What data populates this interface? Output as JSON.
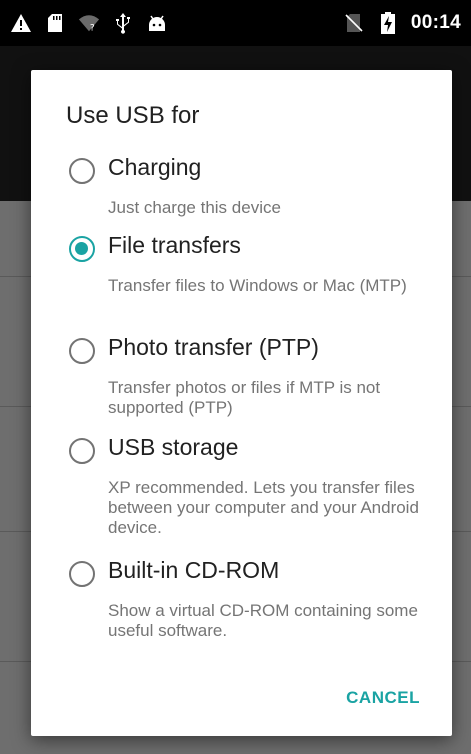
{
  "status_bar": {
    "time": "00:14",
    "icons": [
      "warning-icon",
      "sd-card-icon",
      "wifi-no-connection-icon",
      "usb-icon",
      "android-icon",
      "no-sim-icon",
      "battery-charging-icon"
    ]
  },
  "dialog": {
    "title": "Use USB for",
    "options": [
      {
        "label": "Charging",
        "description": "Just charge this device",
        "selected": false
      },
      {
        "label": "File transfers",
        "description": "Transfer files to Windows or Mac (MTP)",
        "selected": true
      },
      {
        "label": "Photo transfer (PTP)",
        "description": "Transfer photos or files if MTP is not supported (PTP)",
        "selected": false
      },
      {
        "label": "USB storage",
        "description": "XP recommended. Lets you transfer files between your computer and your Android device.",
        "selected": false
      },
      {
        "label": "Built-in CD-ROM",
        "description": "Show a virtual CD-ROM containing some useful software.",
        "selected": false
      }
    ],
    "cancel_label": "CANCEL"
  },
  "colors": {
    "accent": "#1aa3a3",
    "status_bar": "#000000",
    "scrim": "#7a7a7a"
  }
}
